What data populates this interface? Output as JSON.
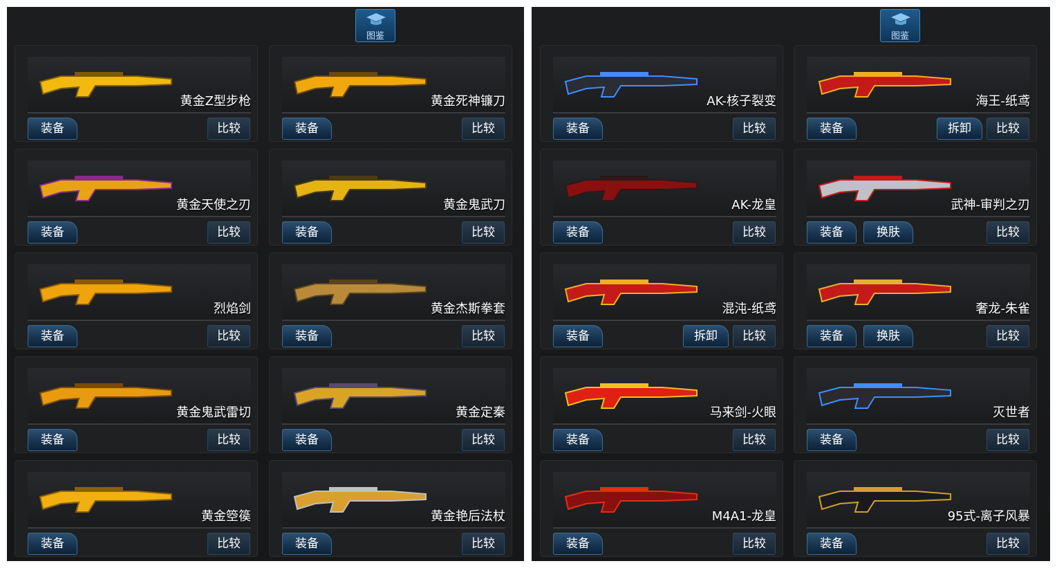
{
  "panels": [
    {
      "header_label": "图鉴",
      "cards": [
        {
          "name": "黄金Z型步枪",
          "equip": "装备",
          "compare": "比较",
          "extra": null,
          "colors": [
            "#f2b90f",
            "#7a5a0a"
          ]
        },
        {
          "name": "黄金死神镰刀",
          "equip": "装备",
          "compare": "比较",
          "extra": null,
          "colors": [
            "#f0a80c",
            "#6e4a08"
          ]
        },
        {
          "name": "黄金天使之刃",
          "equip": "装备",
          "compare": "比较",
          "extra": null,
          "colors": [
            "#e8a315",
            "#8a2a8a"
          ]
        },
        {
          "name": "黄金鬼武刀",
          "equip": "装备",
          "compare": "比较",
          "extra": null,
          "colors": [
            "#e6b412",
            "#4a3a1a"
          ]
        },
        {
          "name": "烈焰剑",
          "equip": "装备",
          "compare": "比较",
          "extra": null,
          "colors": [
            "#f0a40c",
            "#8a5a08"
          ]
        },
        {
          "name": "黄金杰斯拳套",
          "equip": "装备",
          "compare": "比较",
          "extra": null,
          "colors": [
            "#b88a3a",
            "#5a4320"
          ]
        },
        {
          "name": "黄金鬼武雷切",
          "equip": "装备",
          "compare": "比较",
          "extra": null,
          "colors": [
            "#e89a10",
            "#7a4a08"
          ]
        },
        {
          "name": "黄金定秦",
          "equip": "装备",
          "compare": "比较",
          "extra": null,
          "colors": [
            "#d9a425",
            "#5a4a6a"
          ]
        },
        {
          "name": "黄金箜篌",
          "equip": "装备",
          "compare": "比较",
          "extra": null,
          "colors": [
            "#f0b010",
            "#8a6008"
          ]
        },
        {
          "name": "黄金艳后法杖",
          "equip": "装备",
          "compare": "比较",
          "extra": null,
          "colors": [
            "#d9a030",
            "#c0c0c0"
          ]
        }
      ]
    },
    {
      "header_label": "图鉴",
      "cards": [
        {
          "name": "AK-核子裂变",
          "equip": "装备",
          "compare": "比较",
          "extra": null,
          "colors": [
            "#2a2d33",
            "#3f8fff"
          ]
        },
        {
          "name": "海王-纸鸢",
          "equip": "装备",
          "compare": "比较",
          "extra": "拆卸",
          "extra_side": "right",
          "colors": [
            "#c41a1a",
            "#f0b020"
          ]
        },
        {
          "name": "AK-龙皇",
          "equip": "装备",
          "compare": "比较",
          "extra": null,
          "colors": [
            "#8a1010",
            "#2a1a1a"
          ]
        },
        {
          "name": "武神-审判之刃",
          "equip": "装备",
          "compare": "比较",
          "extra": "换肤",
          "extra_side": "left",
          "colors": [
            "#c0c0c8",
            "#c41a1a"
          ]
        },
        {
          "name": "混沌-纸鸢",
          "equip": "装备",
          "compare": "比较",
          "extra": "拆卸",
          "extra_side": "right",
          "colors": [
            "#c41a1a",
            "#f0b020"
          ]
        },
        {
          "name": "奢龙-朱雀",
          "equip": "装备",
          "compare": "比较",
          "extra": "换肤",
          "extra_side": "left",
          "colors": [
            "#c41a1a",
            "#e8b030"
          ]
        },
        {
          "name": "马来剑-火眼",
          "equip": "装备",
          "compare": "比较",
          "extra": null,
          "colors": [
            "#e02010",
            "#f0c020"
          ]
        },
        {
          "name": "灭世者",
          "equip": "装备",
          "compare": "比较",
          "extra": null,
          "colors": [
            "#2a2a30",
            "#3f8fff"
          ]
        },
        {
          "name": "M4A1-龙皇",
          "equip": "装备",
          "compare": "比较",
          "extra": null,
          "colors": [
            "#8a1010",
            "#e03010"
          ]
        },
        {
          "name": "95式-离子风暴",
          "equip": "装备",
          "compare": "比较",
          "extra": null,
          "colors": [
            "#1a1a1c",
            "#d0a030"
          ]
        }
      ]
    }
  ]
}
